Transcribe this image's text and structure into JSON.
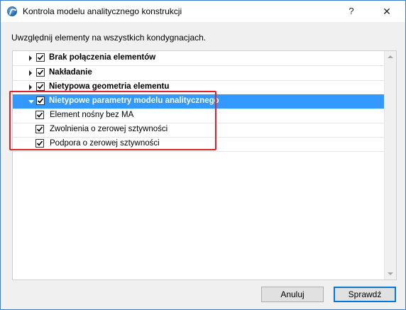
{
  "window": {
    "title": "Kontrola modelu analitycznego konstrukcji",
    "help_label": "?",
    "close_label": "✕"
  },
  "instruction": "Uwzględnij elementy na wszystkich kondygnacjach.",
  "tree": {
    "items": [
      {
        "label": "Brak połączenia elementów",
        "checked": true,
        "level": 0,
        "expanded": false,
        "selected": false
      },
      {
        "label": "Nakładanie",
        "checked": true,
        "level": 0,
        "expanded": false,
        "selected": false
      },
      {
        "label": "Nietypowa geometria elementu",
        "checked": true,
        "level": 0,
        "expanded": false,
        "selected": false
      },
      {
        "label": "Nietypowe parametry modelu analitycznego",
        "checked": true,
        "level": 0,
        "expanded": true,
        "selected": true
      },
      {
        "label": "Element nośny bez MA",
        "checked": true,
        "level": 1,
        "selected": false
      },
      {
        "label": "Zwolnienia o zerowej sztywności",
        "checked": true,
        "level": 1,
        "selected": false
      },
      {
        "label": "Podpora o zerowej sztywności",
        "checked": true,
        "level": 1,
        "selected": false
      }
    ]
  },
  "buttons": {
    "cancel": "Anuluj",
    "check": "Sprawdź"
  },
  "colors": {
    "selection": "#3399ff",
    "highlight_box": "#e0202a",
    "default_button_border": "#0078d7"
  }
}
